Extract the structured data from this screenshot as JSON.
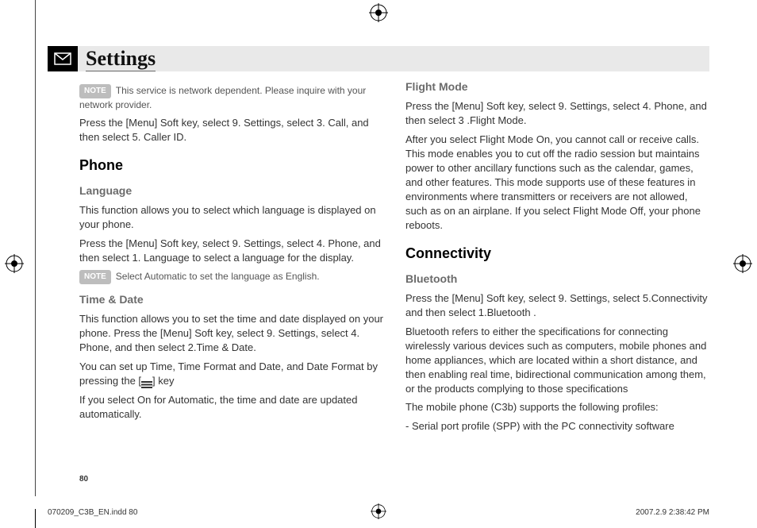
{
  "title": "Settings",
  "page_number": "80",
  "col1": {
    "note_badge": "NOTE",
    "note1": "This service is network dependent. Please inquire with your network provider.",
    "p1": "Press the [Menu] Soft key, select 9. Settings, select 3. Call, and then select 5. Caller ID.",
    "h_phone": "Phone",
    "h_language": "Language",
    "lang_p1": "This function allows you to select which language is displayed on your phone.",
    "lang_p2": "Press the [Menu] Soft key, select 9. Settings, select 4. Phone, and then select 1. Language to select a language for the display.",
    "note2_badge": "NOTE",
    "note2": "Select Automatic to set the language as English.",
    "h_time": "Time & Date",
    "time_p1": "This function allows you to set the time and date displayed on your phone. Press the [Menu] Soft key, select 9. Settings, select 4. Phone, and then select 2.Time & Date.",
    "time_p2_a": "You can set up Time, Time Format and Date, and Date Format by pressing the [",
    "time_p2_b": "] key",
    "time_p3": "If you select On for Automatic, the time and date are updated automatically."
  },
  "col2": {
    "h_flight": "Flight Mode",
    "flight_p1": "Press the [Menu] Soft key, select 9. Settings, select 4. Phone, and then select 3 .Flight Mode.",
    "flight_p2": "After you select Flight Mode On, you cannot call or receive calls. This mode enables you to cut off the radio session but maintains power to other ancillary functions such as the calendar, games, and other features. This mode supports use of these features in environments where transmitters or receivers are not allowed, such as on an airplane. If you select Flight Mode Off, your phone reboots.",
    "h_conn": "Connectivity",
    "h_bt": "Bluetooth",
    "bt_p1": "Press the [Menu] Soft key, select 9. Settings, select 5.Connectivity and then select 1.Bluetooth .",
    "bt_p2": "Bluetooth refers to either the specifications for connecting wirelessly various devices such as computers, mobile phones and home appliances, which are located within a short distance, and then enabling real time, bidirectional communication among them, or the products complying to those specifications",
    "bt_p3": "The mobile phone (C3b) supports the following profiles:",
    "bt_p4": "- Serial port profile (SPP) with the PC connectivity software"
  },
  "footer": {
    "file": "070209_C3B_EN.indd   80",
    "timestamp": "2007.2.9   2:38:42 PM"
  }
}
